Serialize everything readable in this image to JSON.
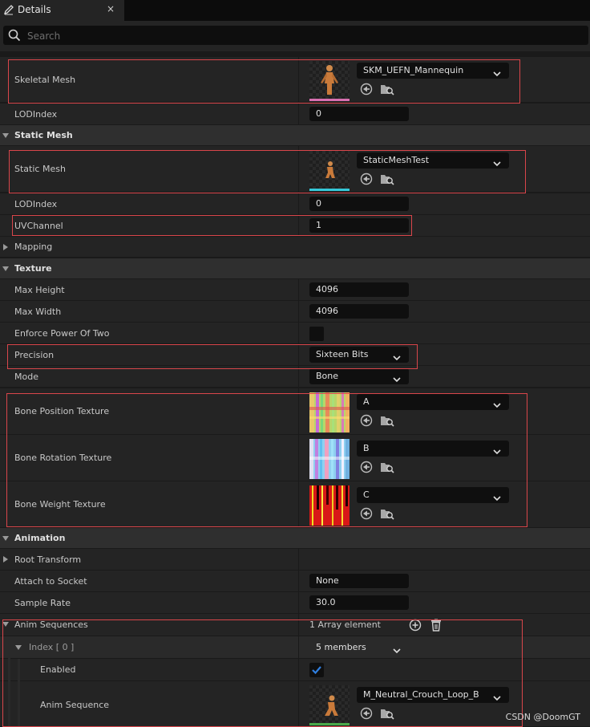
{
  "tab": {
    "title": "Details",
    "close": "×",
    "pen_icon": "pen-icon"
  },
  "search": {
    "placeholder": "Search"
  },
  "skeletal": {
    "mesh_label": "Skeletal Mesh",
    "mesh_value": "SKM_UEFN_Mannequin",
    "lod_label": "LODIndex",
    "lod_value": "0"
  },
  "static_mesh_section": {
    "header": "Static Mesh",
    "mesh_label": "Static Mesh",
    "mesh_value": "StaticMeshTest",
    "lod_label": "LODIndex",
    "lod_value": "0",
    "uv_label": "UVChannel",
    "uv_value": "1"
  },
  "mapping": {
    "header": "Mapping"
  },
  "texture": {
    "header": "Texture",
    "max_height_label": "Max Height",
    "max_height_value": "4096",
    "max_width_label": "Max Width",
    "max_width_value": "4096",
    "enforce_label": "Enforce Power Of Two",
    "precision_label": "Precision",
    "precision_value": "Sixteen Bits",
    "mode_label": "Mode",
    "mode_value": "Bone",
    "bone_position_label": "Bone Position Texture",
    "bone_position_value": "A",
    "bone_rotation_label": "Bone Rotation Texture",
    "bone_rotation_value": "B",
    "bone_weight_label": "Bone Weight Texture",
    "bone_weight_value": "C"
  },
  "animation": {
    "header": "Animation",
    "root_transform_label": "Root Transform",
    "attach_label": "Attach to Socket",
    "attach_value": "None",
    "sample_rate_label": "Sample Rate",
    "sample_rate_value": "30.0",
    "anim_seq_label": "Anim Sequences",
    "anim_seq_value": "1 Array element",
    "index_label": "Index [ 0 ]",
    "index_value": "5 members",
    "enabled_label": "Enabled",
    "enabled": true,
    "anim_sequence_label": "Anim Sequence",
    "anim_sequence_value": "M_Neutral_Crouch_Loop_B"
  },
  "watermark": "CSDN @DoomGT",
  "colors": {
    "highlight_border": "#d9464b",
    "checkbox_tick": "#2f7fe0",
    "panel_bg": "#242424"
  }
}
